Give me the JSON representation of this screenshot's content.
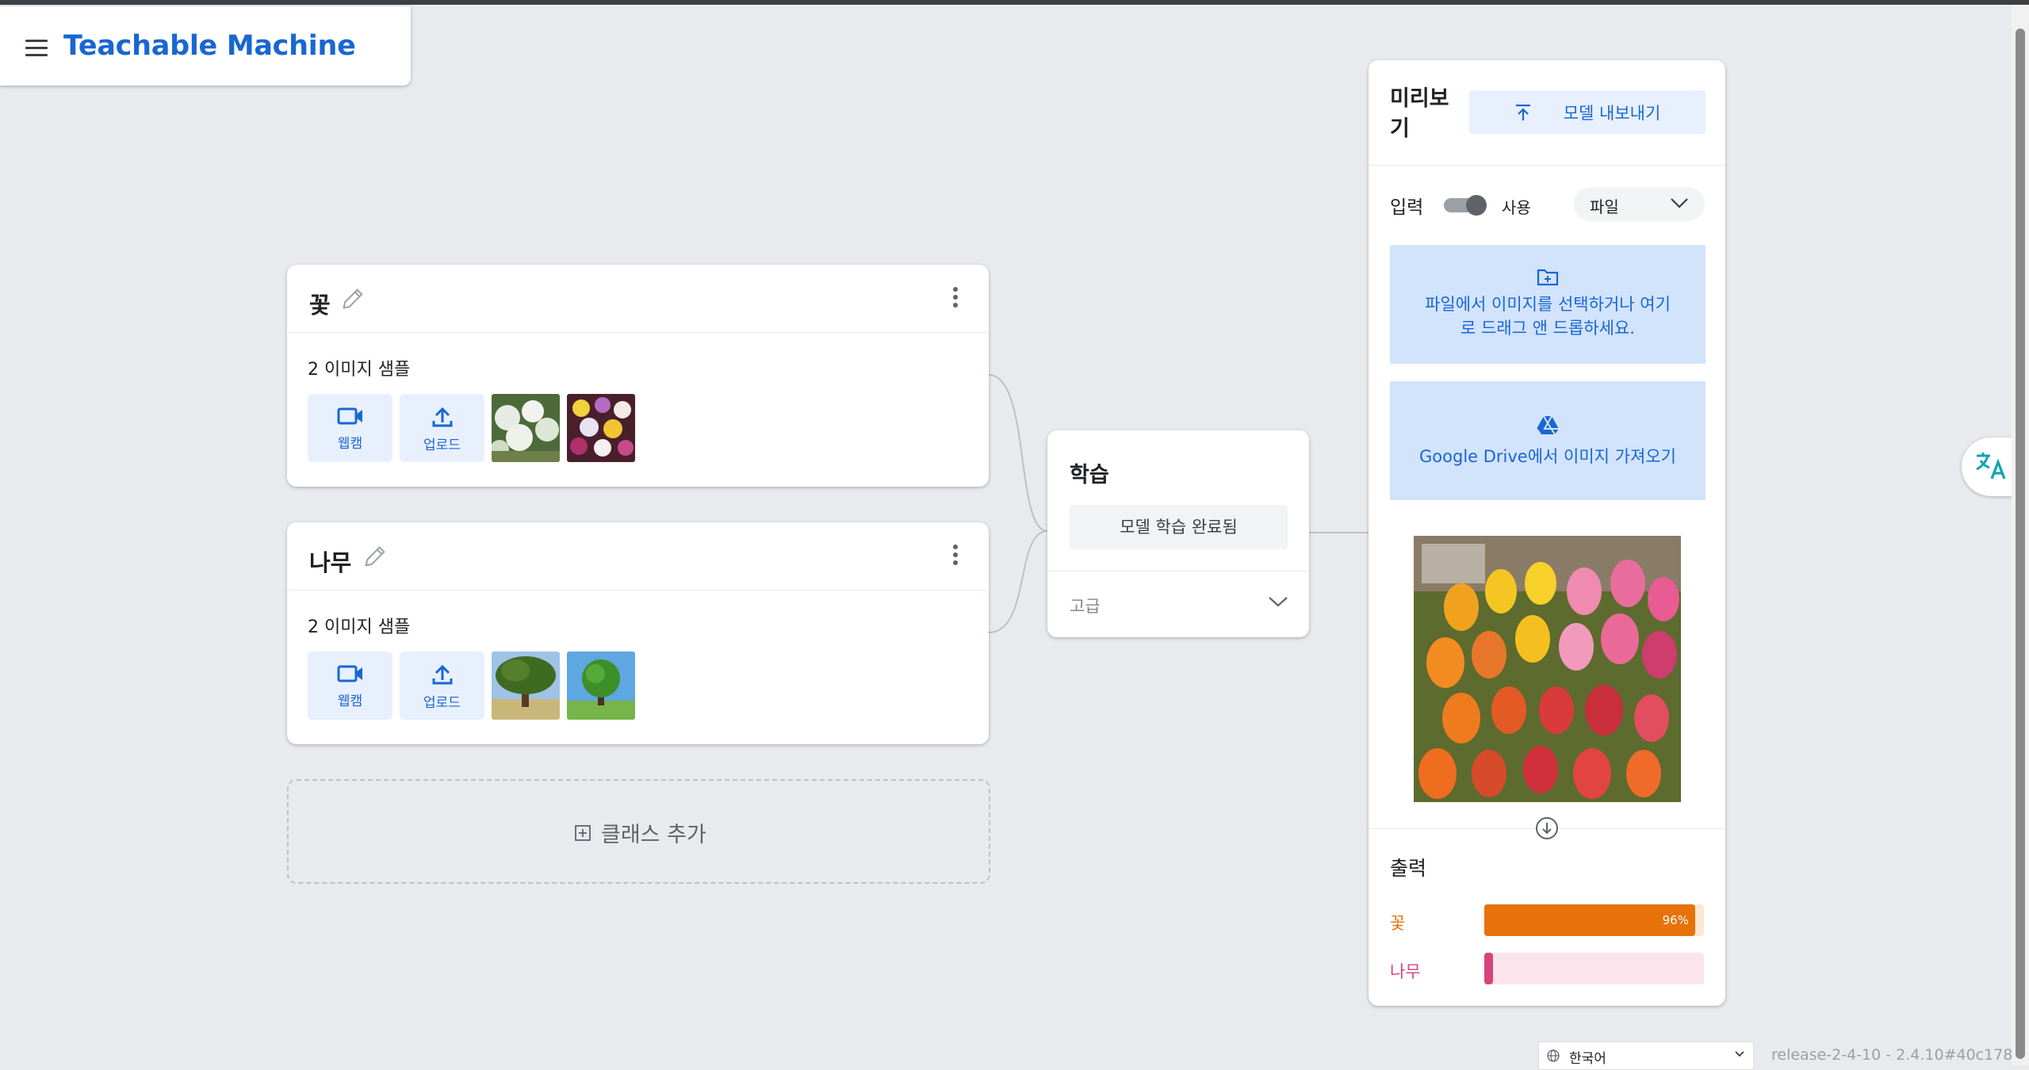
{
  "app": {
    "title": "Teachable Machine"
  },
  "classes": [
    {
      "name": "꽃",
      "sample_count": "2 이미지 샘플",
      "webcam_label": "웹캠",
      "upload_label": "업로드",
      "thumbs": [
        "flower-hydrangea",
        "flower-pansy"
      ]
    },
    {
      "name": "나무",
      "sample_count": "2 이미지 샘플",
      "webcam_label": "웹캠",
      "upload_label": "업로드",
      "thumbs": [
        "tree-field",
        "tree-green"
      ]
    }
  ],
  "add_class": {
    "label": "클래스 추가"
  },
  "training": {
    "title": "학습",
    "button_label": "모델 학습 완료됨",
    "advanced_label": "고급"
  },
  "preview": {
    "title": "미리보기",
    "export_label": "모델 내보내기",
    "input_label": "입력",
    "toggle_label": "사용",
    "toggle_on": true,
    "source_select": "파일",
    "dropzone_text": "파일에서 이미지를 선택하거나 여기로 드래그 앤 드롭하세요.",
    "gdrive_text": "Google Drive에서 이미지 가져오기",
    "output_label": "출력",
    "outputs": [
      {
        "name": "꽃",
        "percent": 96,
        "percent_label": "96%",
        "color": "#e8710a",
        "track": "#fde7d4"
      },
      {
        "name": "나무",
        "percent": 4,
        "percent_label": "",
        "color": "#d6457a",
        "track": "#fce4ec"
      }
    ]
  },
  "footer": {
    "language": "한국어",
    "version": "release-2-4-10 - 2.4.10#40c178"
  },
  "colors": {
    "accent": "#1967d2",
    "background": "#e8eaed"
  }
}
